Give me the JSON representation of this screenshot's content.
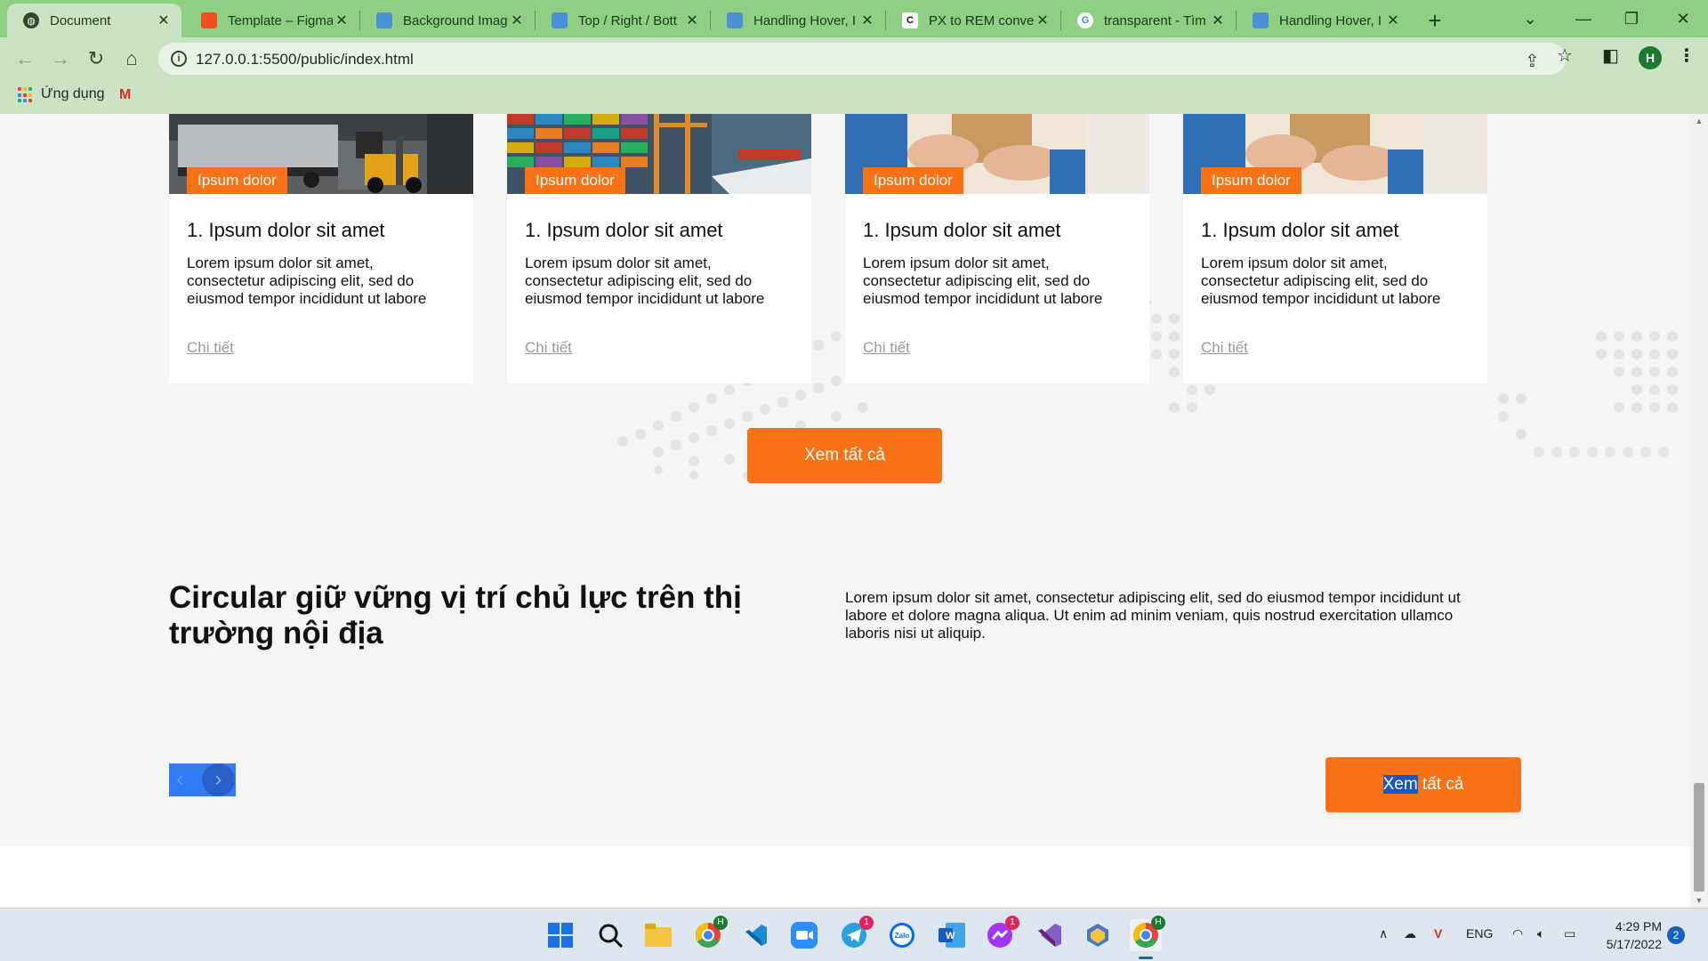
{
  "browser": {
    "tabs": [
      {
        "label": "Document",
        "active": true,
        "icon": "globe-icon"
      },
      {
        "label": "Template – Figma",
        "active": false,
        "icon": "figma-icon"
      },
      {
        "label": "Background Imag",
        "active": false,
        "icon": "mdn-icon"
      },
      {
        "label": "Top / Right / Bott",
        "active": false,
        "icon": "mdn-icon"
      },
      {
        "label": "Handling Hover, I",
        "active": false,
        "icon": "mdn-icon"
      },
      {
        "label": "PX to REM conver",
        "active": false,
        "icon": "c-icon"
      },
      {
        "label": "transparent - Tìm",
        "active": false,
        "icon": "google-icon"
      },
      {
        "label": "Handling Hover, I",
        "active": false,
        "icon": "mdn-icon"
      }
    ],
    "url": "127.0.0.1:5500/public/index.html",
    "profile_initial": "H",
    "bookmarks": {
      "apps_label": "Ứng dụng"
    }
  },
  "cards": [
    {
      "tag": "Ipsum dolor",
      "title": "1. Ipsum dolor sit amet",
      "desc": "Lorem ipsum dolor sit amet, consectetur adipiscing elit, sed do eiusmod tempor incididunt ut labore",
      "link": "Chi tiết",
      "image": "truck-forklift-photo"
    },
    {
      "tag": "Ipsum dolor",
      "title": "1. Ipsum dolor sit amet",
      "desc": "Lorem ipsum dolor sit amet, consectetur adipiscing elit, sed do eiusmod tempor incididunt ut labore",
      "link": "Chi tiết",
      "image": "container-port-photo"
    },
    {
      "tag": "Ipsum dolor",
      "title": "1. Ipsum dolor sit amet",
      "desc": "Lorem ipsum dolor sit amet, consectetur adipiscing elit, sed do eiusmod tempor incididunt ut labore",
      "link": "Chi tiết",
      "image": "package-delivery-photo"
    },
    {
      "tag": "Ipsum dolor",
      "title": "1. Ipsum dolor sit amet",
      "desc": "Lorem ipsum dolor sit amet, consectetur adipiscing elit, sed do eiusmod tempor incididunt ut labore",
      "link": "Chi tiết",
      "image": "package-delivery-photo"
    }
  ],
  "view_all_label": "Xem tất cả",
  "section": {
    "title": "Circular giữ vững vị trí chủ lực trên thị trường nội địa",
    "desc": "Lorem ipsum dolor sit amet, consectetur adipiscing elit, sed do eiusmod tempor incididunt ut labore et dolore magna aliqua. Ut enim ad minim veniam, quis nostrud exercitation ullamco laboris nisi ut aliquip.",
    "button_selected": "Xem",
    "button_rest": " tất cả"
  },
  "taskbar": {
    "apps": [
      "windows-start-icon",
      "search-icon",
      "file-explorer-icon",
      "chrome-icon",
      "vscode-icon",
      "zoom-icon",
      "telegram-icon",
      "zalo-icon",
      "word-icon",
      "messenger-icon",
      "visual-studio-icon",
      "app-icon",
      "chrome-icon"
    ],
    "telegram_badge": "1",
    "messenger_badge": "1",
    "zalo_label": "Zalo",
    "word_label": "W",
    "lang": "ENG",
    "time": "4:29 PM",
    "date": "5/17/2022",
    "notifications": "2"
  },
  "colors": {
    "accent": "#f97316",
    "chrome_tabbar": "#8fcf84",
    "chrome_toolbar": "#c9e3c4",
    "page_bg": "#f5f5f5",
    "slider": "#2f7cf6"
  }
}
